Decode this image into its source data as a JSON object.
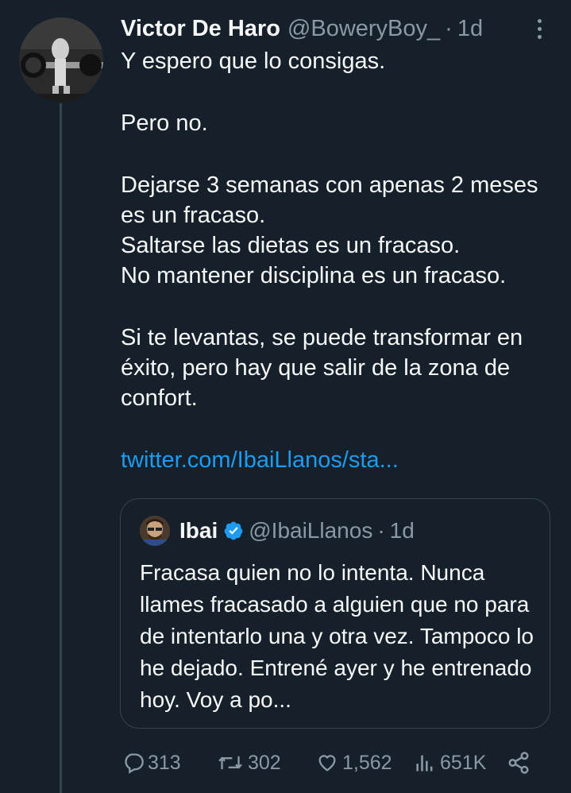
{
  "tweet": {
    "author_name": "Victor De Haro",
    "author_handle": "@BoweryBoy_",
    "separator": "·",
    "time": "1d",
    "paragraphs": [
      "Y espero que lo consigas.",
      "Pero no.",
      "Dejarse 3 semanas con apenas 2 meses es un fracaso.\nSaltarse las dietas es un fracaso.\nNo mantener disciplina es un fracaso.",
      "Si te levantas, se puede transformar en éxito, pero hay que salir de la zona de confort."
    ],
    "link": "twitter.com/IbaiLlanos/sta..."
  },
  "quote": {
    "author_name": "Ibai",
    "author_handle": "@IbaiLlanos",
    "separator": "·",
    "time": "1d",
    "text": "Fracasa quien no lo intenta. Nunca llames fracasado a alguien que no para de intentarlo una y otra vez. Tampoco lo he dejado. Entrené ayer y he entrenado hoy. Voy a po..."
  },
  "actions": {
    "replies": "313",
    "retweets": "302",
    "likes": "1,562",
    "views": "651K"
  },
  "icons": {
    "more": "more-vertical-icon",
    "reply": "reply-icon",
    "retweet": "retweet-icon",
    "like": "heart-icon",
    "views": "views-icon",
    "share": "share-icon",
    "verified": "verified-badge-icon"
  },
  "colors": {
    "background": "#15202b",
    "text": "#f7f9f9",
    "secondary": "#8b98a5",
    "link": "#1d9bf0",
    "border": "#38444d",
    "verified": "#1d9bf0"
  }
}
